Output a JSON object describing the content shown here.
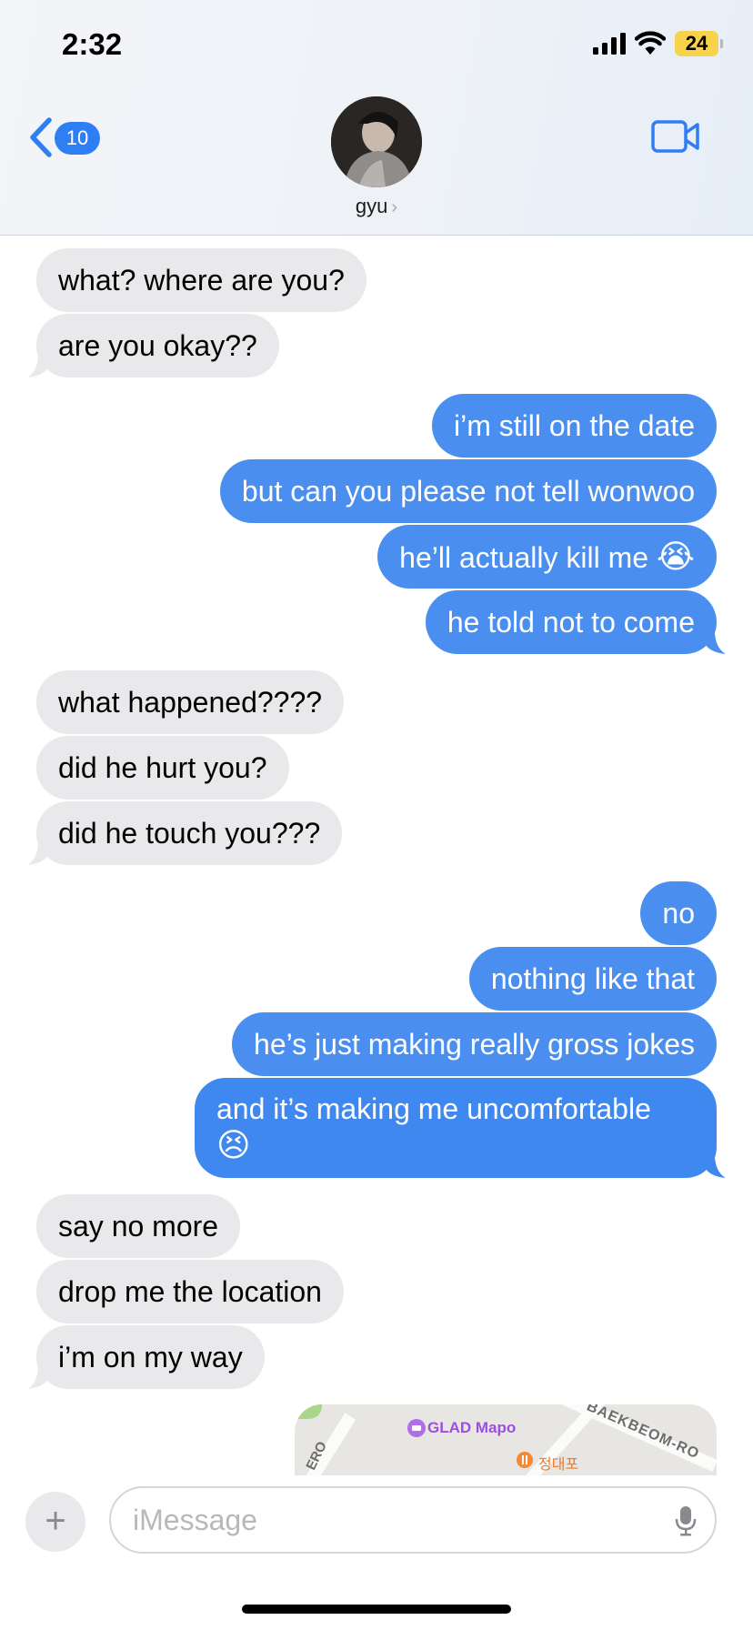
{
  "status_bar": {
    "time": "2:32",
    "battery": "24",
    "signal_icon": "cellular-signal-icon",
    "wifi_icon": "wifi-icon"
  },
  "header": {
    "back_count": "10",
    "contact_name": "gyu",
    "video_icon": "video-camera-icon"
  },
  "messages": [
    {
      "from": "them",
      "text": "what? where are you?"
    },
    {
      "from": "them",
      "text": "are you okay??"
    },
    {
      "from": "me",
      "text": "i’m still on the date"
    },
    {
      "from": "me",
      "text": "but can you please not tell wonwoo"
    },
    {
      "from": "me",
      "text": "he’ll actually kill me",
      "emoji": "😭"
    },
    {
      "from": "me",
      "text": "he told not to come"
    },
    {
      "from": "them",
      "text": "what happened????"
    },
    {
      "from": "them",
      "text": "did he hurt you?"
    },
    {
      "from": "them",
      "text": "did he touch you???"
    },
    {
      "from": "me",
      "text": "no"
    },
    {
      "from": "me",
      "text": "nothing like that"
    },
    {
      "from": "me",
      "text": "he’s just making really gross jokes"
    },
    {
      "from": "me",
      "text": "and it’s making me uncomfortable",
      "emoji": "😣"
    },
    {
      "from": "them",
      "text": "say no more"
    },
    {
      "from": "them",
      "text": "drop me the location"
    },
    {
      "from": "them",
      "text": "i’m on my way"
    }
  ],
  "map_preview": {
    "place_label": "GLAD Mapo",
    "food_label": "정대포",
    "road_label": "BAEKBEOM-RO",
    "partial_road_label": "ERO"
  },
  "input": {
    "placeholder": "iMessage"
  },
  "colors": {
    "outgoing_bubble": "#4a8ff0",
    "incoming_bubble": "#e9e9eb",
    "accent": "#2f7ef3"
  }
}
